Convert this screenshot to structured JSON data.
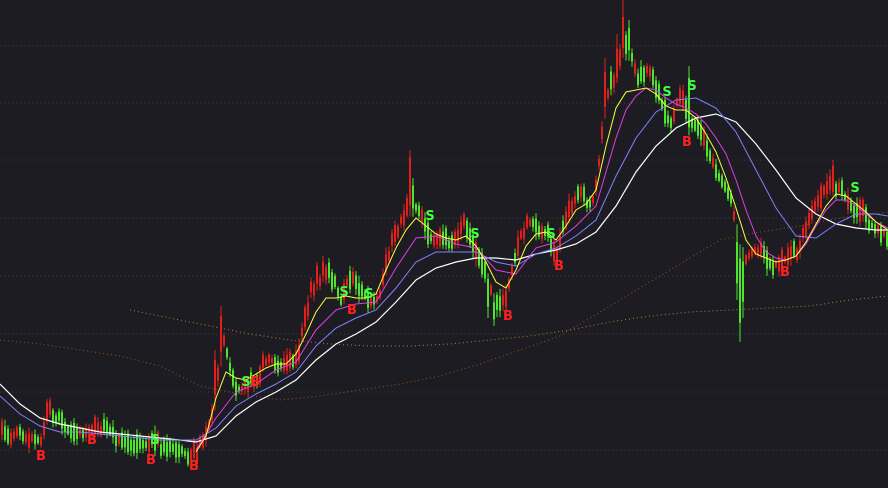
{
  "chart_data": {
    "type": "candlestick",
    "title": "",
    "xlabel": "",
    "ylabel": "",
    "grid": true,
    "colors": {
      "background": "#1c1c22",
      "grid": "#3a3a44",
      "up": "#e0201a",
      "down": "#4ee62a",
      "ma_fast": "#ffff40",
      "ma_mid": "#e040e0",
      "ma_slow": "#8080ff",
      "ma_long": "#ffffff",
      "ma_very_long": "#c08030",
      "ma_dotted": "#a05018",
      "buy": "#ff2020",
      "sell": "#40ff40"
    },
    "buy_label": "B",
    "sell_label": "S",
    "ylim": [
      0,
      488
    ],
    "anchors": [
      [
        0,
        430
      ],
      [
        8,
        440
      ],
      [
        16,
        432
      ],
      [
        22,
        440
      ],
      [
        32,
        436
      ],
      [
        40,
        440
      ],
      [
        46,
        410
      ],
      [
        56,
        418
      ],
      [
        66,
        428
      ],
      [
        74,
        432
      ],
      [
        84,
        434
      ],
      [
        92,
        428
      ],
      [
        100,
        426
      ],
      [
        108,
        430
      ],
      [
        116,
        438
      ],
      [
        126,
        442
      ],
      [
        134,
        444
      ],
      [
        144,
        446
      ],
      [
        152,
        440
      ],
      [
        162,
        446
      ],
      [
        170,
        448
      ],
      [
        180,
        452
      ],
      [
        188,
        454
      ],
      [
        194,
        452
      ],
      [
        200,
        440
      ],
      [
        206,
        430
      ],
      [
        212,
        410
      ],
      [
        216,
        380
      ],
      [
        222,
        340
      ],
      [
        228,
        360
      ],
      [
        234,
        388
      ],
      [
        240,
        390
      ],
      [
        248,
        384
      ],
      [
        256,
        378
      ],
      [
        264,
        362
      ],
      [
        272,
        360
      ],
      [
        280,
        364
      ],
      [
        290,
        362
      ],
      [
        298,
        350
      ],
      [
        304,
        320
      ],
      [
        310,
        292
      ],
      [
        318,
        280
      ],
      [
        326,
        270
      ],
      [
        334,
        284
      ],
      [
        340,
        300
      ],
      [
        346,
        280
      ],
      [
        352,
        276
      ],
      [
        358,
        290
      ],
      [
        366,
        298
      ],
      [
        374,
        304
      ],
      [
        380,
        290
      ],
      [
        386,
        256
      ],
      [
        392,
        240
      ],
      [
        398,
        228
      ],
      [
        404,
        212
      ],
      [
        410,
        200
      ],
      [
        416,
        210
      ],
      [
        422,
        222
      ],
      [
        428,
        236
      ],
      [
        434,
        242
      ],
      [
        440,
        232
      ],
      [
        446,
        238
      ],
      [
        452,
        248
      ],
      [
        458,
        230
      ],
      [
        464,
        222
      ],
      [
        470,
        238
      ],
      [
        476,
        254
      ],
      [
        482,
        266
      ],
      [
        488,
        286
      ],
      [
        494,
        300
      ],
      [
        500,
        304
      ],
      [
        506,
        288
      ],
      [
        512,
        268
      ],
      [
        518,
        240
      ],
      [
        524,
        226
      ],
      [
        530,
        222
      ],
      [
        536,
        230
      ],
      [
        542,
        228
      ],
      [
        548,
        238
      ],
      [
        554,
        256
      ],
      [
        560,
        238
      ],
      [
        566,
        212
      ],
      [
        572,
        204
      ],
      [
        578,
        196
      ],
      [
        584,
        200
      ],
      [
        590,
        206
      ],
      [
        596,
        184
      ],
      [
        600,
        140
      ],
      [
        604,
        104
      ],
      [
        610,
        84
      ],
      [
        616,
        74
      ],
      [
        622,
        44
      ],
      [
        628,
        48
      ],
      [
        634,
        70
      ],
      [
        640,
        78
      ],
      [
        646,
        68
      ],
      [
        652,
        82
      ],
      [
        658,
        92
      ],
      [
        664,
        112
      ],
      [
        670,
        122
      ],
      [
        676,
        102
      ],
      [
        682,
        96
      ],
      [
        688,
        120
      ],
      [
        694,
        124
      ],
      [
        700,
        132
      ],
      [
        706,
        148
      ],
      [
        712,
        162
      ],
      [
        718,
        176
      ],
      [
        724,
        188
      ],
      [
        730,
        196
      ],
      [
        736,
        238
      ],
      [
        742,
        262
      ],
      [
        748,
        256
      ],
      [
        754,
        248
      ],
      [
        760,
        252
      ],
      [
        766,
        260
      ],
      [
        772,
        266
      ],
      [
        778,
        262
      ],
      [
        784,
        260
      ],
      [
        790,
        250
      ],
      [
        796,
        252
      ],
      [
        802,
        238
      ],
      [
        808,
        218
      ],
      [
        814,
        204
      ],
      [
        820,
        196
      ],
      [
        826,
        186
      ],
      [
        832,
        184
      ],
      [
        838,
        190
      ],
      [
        844,
        196
      ],
      [
        850,
        204
      ],
      [
        856,
        212
      ],
      [
        862,
        210
      ],
      [
        868,
        220
      ],
      [
        874,
        228
      ],
      [
        880,
        232
      ],
      [
        888,
        236
      ]
    ],
    "spikes": [
      [
        214,
        350
      ],
      [
        220,
        306
      ],
      [
        316,
        262
      ],
      [
        322,
        256
      ],
      [
        408,
        184
      ],
      [
        410,
        150
      ],
      [
        412,
        178
      ],
      [
        604,
        58
      ],
      [
        610,
        66
      ],
      [
        616,
        34
      ],
      [
        622,
        0
      ],
      [
        628,
        20
      ],
      [
        640,
        60
      ],
      [
        656,
        76
      ],
      [
        688,
        66
      ],
      [
        734,
        232
      ],
      [
        740,
        342
      ],
      [
        828,
        170
      ],
      [
        832,
        160
      ]
    ],
    "dips": [
      [
        196,
        470
      ],
      [
        488,
        318
      ],
      [
        494,
        326
      ],
      [
        504,
        312
      ],
      [
        556,
        270
      ],
      [
        736,
        300
      ],
      [
        740,
        342
      ],
      [
        742,
        318
      ],
      [
        782,
        274
      ]
    ],
    "buy_signals": [
      [
        41,
        460
      ],
      [
        92,
        444
      ],
      [
        151,
        464
      ],
      [
        194,
        470
      ],
      [
        255,
        386
      ],
      [
        352,
        314
      ],
      [
        508,
        320
      ],
      [
        559,
        270
      ],
      [
        687,
        146
      ],
      [
        785,
        276
      ]
    ],
    "sell_signals": [
      [
        155,
        444
      ],
      [
        246,
        386
      ],
      [
        344,
        296
      ],
      [
        369,
        298
      ],
      [
        430,
        220
      ],
      [
        475,
        238
      ],
      [
        551,
        238
      ],
      [
        667,
        96
      ],
      [
        692,
        90
      ],
      [
        855,
        192
      ]
    ],
    "ma_fast": [
      [
        196,
        452
      ],
      [
        206,
        436
      ],
      [
        216,
        398
      ],
      [
        226,
        372
      ],
      [
        236,
        378
      ],
      [
        246,
        380
      ],
      [
        256,
        374
      ],
      [
        266,
        368
      ],
      [
        276,
        364
      ],
      [
        286,
        364
      ],
      [
        296,
        354
      ],
      [
        306,
        334
      ],
      [
        316,
        312
      ],
      [
        326,
        298
      ],
      [
        336,
        298
      ],
      [
        346,
        296
      ],
      [
        356,
        298
      ],
      [
        366,
        298
      ],
      [
        376,
        294
      ],
      [
        386,
        270
      ],
      [
        396,
        248
      ],
      [
        406,
        230
      ],
      [
        416,
        218
      ],
      [
        426,
        226
      ],
      [
        436,
        234
      ],
      [
        446,
        238
      ],
      [
        456,
        240
      ],
      [
        466,
        236
      ],
      [
        476,
        246
      ],
      [
        486,
        262
      ],
      [
        496,
        282
      ],
      [
        506,
        288
      ],
      [
        516,
        270
      ],
      [
        526,
        246
      ],
      [
        536,
        234
      ],
      [
        546,
        232
      ],
      [
        556,
        240
      ],
      [
        566,
        226
      ],
      [
        576,
        210
      ],
      [
        586,
        204
      ],
      [
        596,
        190
      ],
      [
        606,
        146
      ],
      [
        616,
        108
      ],
      [
        626,
        92
      ],
      [
        636,
        90
      ],
      [
        646,
        88
      ],
      [
        656,
        94
      ],
      [
        666,
        106
      ],
      [
        676,
        110
      ],
      [
        686,
        110
      ],
      [
        696,
        118
      ],
      [
        706,
        134
      ],
      [
        716,
        152
      ],
      [
        726,
        178
      ],
      [
        736,
        208
      ],
      [
        746,
        240
      ],
      [
        756,
        254
      ],
      [
        766,
        258
      ],
      [
        776,
        262
      ],
      [
        786,
        260
      ],
      [
        796,
        256
      ],
      [
        806,
        242
      ],
      [
        816,
        224
      ],
      [
        826,
        206
      ],
      [
        836,
        194
      ],
      [
        846,
        196
      ],
      [
        856,
        204
      ],
      [
        866,
        212
      ],
      [
        876,
        222
      ],
      [
        888,
        230
      ]
    ],
    "ma_mid": [
      [
        196,
        450
      ],
      [
        216,
        418
      ],
      [
        236,
        392
      ],
      [
        256,
        384
      ],
      [
        276,
        370
      ],
      [
        296,
        362
      ],
      [
        316,
        330
      ],
      [
        336,
        310
      ],
      [
        356,
        304
      ],
      [
        376,
        302
      ],
      [
        396,
        268
      ],
      [
        416,
        238
      ],
      [
        436,
        236
      ],
      [
        456,
        244
      ],
      [
        476,
        248
      ],
      [
        496,
        270
      ],
      [
        516,
        274
      ],
      [
        536,
        248
      ],
      [
        556,
        242
      ],
      [
        576,
        226
      ],
      [
        596,
        206
      ],
      [
        606,
        172
      ],
      [
        616,
        138
      ],
      [
        626,
        110
      ],
      [
        636,
        96
      ],
      [
        646,
        88
      ],
      [
        656,
        90
      ],
      [
        666,
        98
      ],
      [
        676,
        104
      ],
      [
        686,
        108
      ],
      [
        696,
        114
      ],
      [
        706,
        124
      ],
      [
        716,
        138
      ],
      [
        726,
        154
      ],
      [
        736,
        180
      ],
      [
        746,
        210
      ],
      [
        756,
        236
      ],
      [
        766,
        252
      ],
      [
        776,
        258
      ],
      [
        786,
        260
      ],
      [
        796,
        256
      ],
      [
        806,
        244
      ],
      [
        816,
        226
      ],
      [
        826,
        210
      ],
      [
        836,
        200
      ],
      [
        846,
        200
      ],
      [
        856,
        206
      ],
      [
        866,
        214
      ],
      [
        876,
        222
      ],
      [
        888,
        228
      ]
    ],
    "ma_slow": [
      [
        0,
        396
      ],
      [
        20,
        414
      ],
      [
        40,
        426
      ],
      [
        60,
        432
      ],
      [
        80,
        432
      ],
      [
        100,
        434
      ],
      [
        120,
        436
      ],
      [
        140,
        438
      ],
      [
        160,
        440
      ],
      [
        180,
        440
      ],
      [
        196,
        440
      ],
      [
        216,
        428
      ],
      [
        236,
        406
      ],
      [
        256,
        394
      ],
      [
        276,
        384
      ],
      [
        296,
        372
      ],
      [
        316,
        346
      ],
      [
        336,
        328
      ],
      [
        356,
        318
      ],
      [
        376,
        310
      ],
      [
        396,
        288
      ],
      [
        416,
        262
      ],
      [
        436,
        252
      ],
      [
        456,
        252
      ],
      [
        476,
        252
      ],
      [
        496,
        262
      ],
      [
        516,
        266
      ],
      [
        536,
        254
      ],
      [
        556,
        248
      ],
      [
        576,
        236
      ],
      [
        596,
        220
      ],
      [
        616,
        176
      ],
      [
        636,
        138
      ],
      [
        656,
        112
      ],
      [
        676,
        100
      ],
      [
        696,
        98
      ],
      [
        716,
        108
      ],
      [
        736,
        132
      ],
      [
        756,
        170
      ],
      [
        776,
        208
      ],
      [
        796,
        236
      ],
      [
        816,
        238
      ],
      [
        836,
        224
      ],
      [
        856,
        214
      ],
      [
        876,
        214
      ],
      [
        888,
        216
      ]
    ],
    "ma_long": [
      [
        0,
        384
      ],
      [
        20,
        404
      ],
      [
        40,
        418
      ],
      [
        60,
        424
      ],
      [
        80,
        428
      ],
      [
        100,
        432
      ],
      [
        120,
        434
      ],
      [
        140,
        436
      ],
      [
        160,
        438
      ],
      [
        180,
        440
      ],
      [
        196,
        442
      ],
      [
        216,
        436
      ],
      [
        236,
        416
      ],
      [
        256,
        402
      ],
      [
        276,
        392
      ],
      [
        296,
        380
      ],
      [
        316,
        360
      ],
      [
        336,
        344
      ],
      [
        356,
        334
      ],
      [
        376,
        322
      ],
      [
        396,
        302
      ],
      [
        416,
        280
      ],
      [
        436,
        268
      ],
      [
        456,
        262
      ],
      [
        476,
        258
      ],
      [
        496,
        258
      ],
      [
        516,
        260
      ],
      [
        536,
        254
      ],
      [
        556,
        250
      ],
      [
        576,
        244
      ],
      [
        596,
        232
      ],
      [
        616,
        206
      ],
      [
        636,
        172
      ],
      [
        656,
        146
      ],
      [
        676,
        128
      ],
      [
        696,
        118
      ],
      [
        716,
        114
      ],
      [
        736,
        122
      ],
      [
        756,
        144
      ],
      [
        776,
        170
      ],
      [
        796,
        198
      ],
      [
        816,
        214
      ],
      [
        836,
        224
      ],
      [
        856,
        228
      ],
      [
        876,
        230
      ],
      [
        888,
        230
      ]
    ],
    "ma_very_long": [
      [
        130,
        310
      ],
      [
        170,
        318
      ],
      [
        210,
        326
      ],
      [
        250,
        334
      ],
      [
        290,
        340
      ],
      [
        330,
        344
      ],
      [
        370,
        346
      ],
      [
        410,
        346
      ],
      [
        450,
        344
      ],
      [
        490,
        340
      ],
      [
        530,
        336
      ],
      [
        570,
        330
      ],
      [
        610,
        322
      ],
      [
        650,
        316
      ],
      [
        690,
        312
      ],
      [
        730,
        310
      ],
      [
        770,
        308
      ],
      [
        810,
        306
      ],
      [
        850,
        300
      ],
      [
        888,
        296
      ]
    ],
    "ma_dotted": [
      [
        0,
        340
      ],
      [
        40,
        344
      ],
      [
        80,
        350
      ],
      [
        120,
        356
      ],
      [
        160,
        366
      ],
      [
        200,
        386
      ],
      [
        240,
        394
      ],
      [
        280,
        400
      ],
      [
        320,
        396
      ],
      [
        360,
        390
      ],
      [
        400,
        384
      ],
      [
        440,
        376
      ],
      [
        480,
        364
      ],
      [
        520,
        350
      ],
      [
        560,
        336
      ],
      [
        600,
        312
      ],
      [
        640,
        288
      ],
      [
        680,
        264
      ],
      [
        720,
        240
      ],
      [
        760,
        232
      ],
      [
        800,
        226
      ],
      [
        840,
        218
      ],
      [
        888,
        212
      ]
    ]
  }
}
